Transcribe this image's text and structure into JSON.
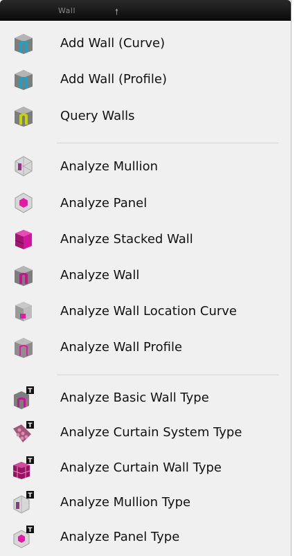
{
  "menu": {
    "title": "Wall",
    "groups": [
      {
        "items": [
          {
            "label": "Add Wall (Curve)",
            "icon": "wall-arch-cyan-icon"
          },
          {
            "label": "Add Wall (Profile)",
            "icon": "wall-arch-cyan-icon"
          },
          {
            "label": "Query Walls",
            "icon": "wall-arch-yellow-icon"
          }
        ]
      },
      {
        "items": [
          {
            "label": "Analyze Mullion",
            "icon": "hex-mullion-icon"
          },
          {
            "label": "Analyze Panel",
            "icon": "hex-panel-icon"
          },
          {
            "label": "Analyze Stacked Wall",
            "icon": "stacked-wall-icon"
          },
          {
            "label": "Analyze Wall",
            "icon": "wall-arch-magenta-icon"
          },
          {
            "label": "Analyze Wall Location Curve",
            "icon": "wall-location-curve-icon"
          },
          {
            "label": "Analyze Wall Profile",
            "icon": "wall-profile-icon"
          }
        ]
      },
      {
        "items": [
          {
            "label": "Analyze Basic Wall Type",
            "icon": "basic-wall-type-icon"
          },
          {
            "label": "Analyze Curtain System Type",
            "icon": "curtain-system-type-icon"
          },
          {
            "label": "Analyze Curtain Wall Type",
            "icon": "curtain-wall-type-icon"
          },
          {
            "label": "Analyze Mullion Type",
            "icon": "mullion-type-icon"
          },
          {
            "label": "Analyze Panel Type",
            "icon": "panel-type-icon"
          }
        ]
      }
    ]
  },
  "colors": {
    "cyan": "#1aa3c8",
    "yellow": "#c6d600",
    "magenta": "#e21aa6",
    "gray": "#8f8f8f",
    "type_badge": "#111111"
  }
}
